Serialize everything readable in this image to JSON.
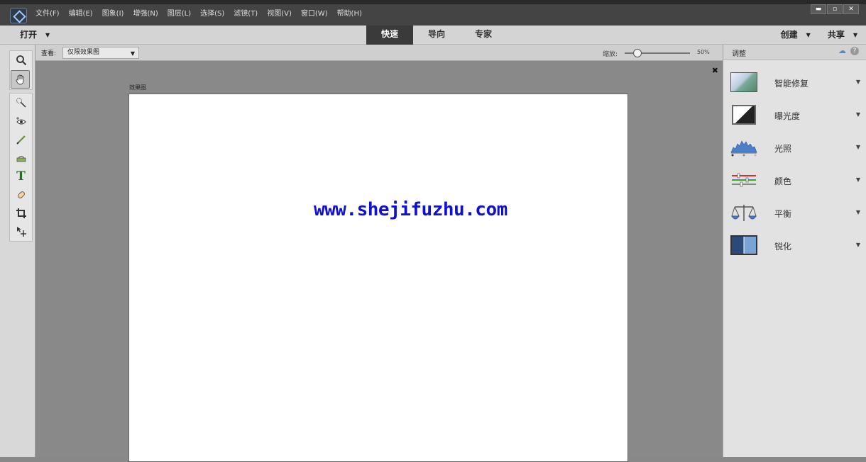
{
  "menu": {
    "items": [
      "文件(F)",
      "编辑(E)",
      "图象(I)",
      "增强(N)",
      "图层(L)",
      "选择(S)",
      "滤镜(T)",
      "视图(V)",
      "窗口(W)",
      "帮助(H)"
    ]
  },
  "window_buttons": [
    "▬",
    "▫",
    "✕"
  ],
  "modebar": {
    "open_label": "打开",
    "tabs": [
      "快速",
      "导向",
      "专家"
    ],
    "active_tab": "快速",
    "create_label": "创建",
    "share_label": "共享"
  },
  "subbar": {
    "view_label": "查看:",
    "view_value": "仅限效果图",
    "zoom_label": "缩放:",
    "zoom_value": "50%",
    "zoom_level": 0.5
  },
  "canvas": {
    "doc_title": "效果图",
    "watermark": "www.shejifuzhu.com",
    "close_glyph": "✖"
  },
  "panel": {
    "title": "调整",
    "adjustments": [
      {
        "label": "智能修复",
        "icon": "smart-fix-icon"
      },
      {
        "label": "曝光度",
        "icon": "exposure-icon"
      },
      {
        "label": "光照",
        "icon": "lighting-icon"
      },
      {
        "label": "颜色",
        "icon": "color-icon"
      },
      {
        "label": "平衡",
        "icon": "balance-icon"
      },
      {
        "label": "锐化",
        "icon": "sharpen-icon"
      }
    ]
  },
  "colors": {
    "watermark": "#1010d0",
    "active_tab_bg": "#3a3a3a"
  }
}
